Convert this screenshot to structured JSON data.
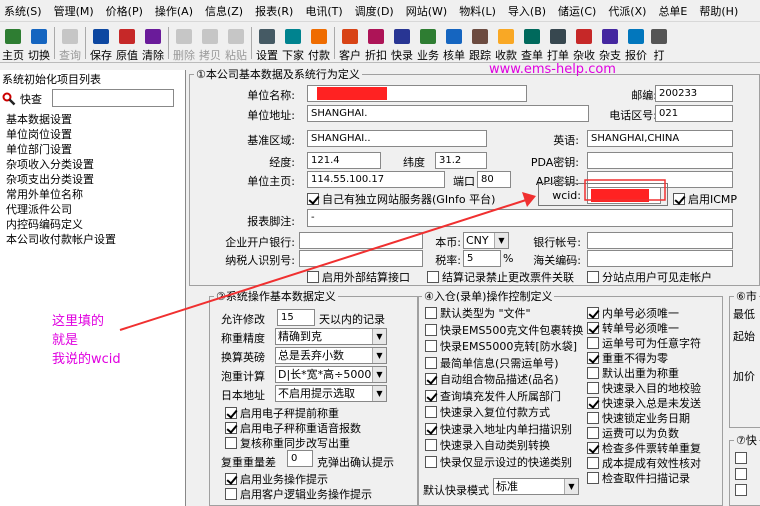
{
  "menu": [
    "系统(S)",
    "管理(M)",
    "价格(P)",
    "操作(A)",
    "信息(Z)",
    "报表(R)",
    "电讯(T)",
    "调度(D)",
    "网站(W)",
    "物料(L)",
    "导入(B)",
    "储运(C)",
    "代派(X)",
    "总单E",
    "帮助(H)"
  ],
  "toolbar": [
    {
      "label": "主页",
      "icon": "home-icon",
      "color": "#2e7d32",
      "disabled": false
    },
    {
      "label": "切换",
      "icon": "switch-icon",
      "color": "#1565c0",
      "disabled": false
    },
    {
      "label": "查询",
      "icon": "query-icon",
      "color": "#777",
      "disabled": true
    },
    {
      "label": "保存",
      "icon": "save-icon",
      "color": "#0d47a1",
      "disabled": false
    },
    {
      "label": "原值",
      "icon": "original-value-icon",
      "color": "#c62828",
      "disabled": false
    },
    {
      "label": "清除",
      "icon": "clear-icon",
      "color": "#6a1b9a",
      "disabled": false
    },
    {
      "label": "删除",
      "icon": "delete-icon",
      "color": "#777",
      "disabled": true
    },
    {
      "label": "拷贝",
      "icon": "copy-icon",
      "color": "#777",
      "disabled": true
    },
    {
      "label": "粘贴",
      "icon": "paste-icon",
      "color": "#777",
      "disabled": true
    },
    {
      "label": "设置",
      "icon": "settings-icon",
      "color": "#455a64",
      "disabled": false
    },
    {
      "label": "下家",
      "icon": "next-party-icon",
      "color": "#00838f",
      "disabled": false
    },
    {
      "label": "付款",
      "icon": "payment-icon",
      "color": "#ef6c00",
      "disabled": false
    },
    {
      "label": "客户",
      "icon": "customer-icon",
      "color": "#d84315",
      "disabled": false
    },
    {
      "label": "折扣",
      "icon": "discount-icon",
      "color": "#ad1457",
      "disabled": false
    },
    {
      "label": "快录",
      "icon": "quick-entry-icon",
      "color": "#283593",
      "disabled": false
    },
    {
      "label": "业务",
      "icon": "business-icon",
      "color": "#2e7d32",
      "disabled": false
    },
    {
      "label": "核单",
      "icon": "verify-icon",
      "color": "#1565c0",
      "disabled": false
    },
    {
      "label": "跟踪",
      "icon": "tracking-icon",
      "color": "#6d4c41",
      "disabled": false
    },
    {
      "label": "收款",
      "icon": "receipt-icon",
      "color": "#f9a825",
      "disabled": false
    },
    {
      "label": "查单",
      "icon": "check-order-icon",
      "color": "#00695c",
      "disabled": false
    },
    {
      "label": "打单",
      "icon": "print-icon",
      "color": "#37474f",
      "disabled": false
    },
    {
      "label": "杂收",
      "icon": "misc-income-icon",
      "color": "#c62828",
      "disabled": false
    },
    {
      "label": "杂支",
      "icon": "misc-expense-icon",
      "color": "#4527a0",
      "disabled": false
    },
    {
      "label": "报价",
      "icon": "quote-icon",
      "color": "#0277bd",
      "disabled": false
    },
    {
      "label": "打",
      "icon": "print2-icon",
      "color": "#555",
      "disabled": false
    }
  ],
  "left_panel": {
    "title": "系统初始化项目列表",
    "search_label": "快查",
    "items": [
      "基本数据设置",
      "单位岗位设置",
      "单位部门设置",
      "杂项收入分类设置",
      "杂项支出分类设置",
      "常用外单位名称",
      "代理派件公司",
      "内控码编码定义",
      "本公司收付款帐户设置"
    ]
  },
  "watermark": "www.ems-help.com",
  "annotation": "这里填的\n就是\n我说的wcid",
  "section1": {
    "legend": "①本公司基本数据及系统行为定义",
    "unit_name_label": "单位名称:",
    "postcode_label": "邮编:",
    "postcode": "200233",
    "address_label": "单位地址:",
    "address": "SHANGHAI.",
    "area_code_label": "电话区号:",
    "area_code": "021",
    "region_label": "基准区域:",
    "region": "SHANGHAI..",
    "english_label": "英语:",
    "english": "SHANGHAI,CHINA",
    "longitude_label": "经度:",
    "longitude": "121.4",
    "latitude_label": "纬度",
    "latitude": "31.2",
    "pda_label": "PDA密钥:",
    "homepage_label": "单位主页:",
    "homepage": "114.55.100.17",
    "port_label": "端口",
    "port": "80",
    "api_label": "API密钥:",
    "own_server_label": "自己有独立网站服务器(GInfo 平台)",
    "wcid_label": "wcid:",
    "enable_icmp_label": "启用ICMP",
    "footer_label": "报表脚注:",
    "footer": "-",
    "bank_label": "企业开户银行:",
    "currency_label": "本币:",
    "currency": "CNY",
    "account_label": "银行帐号:",
    "taxpayer_label": "纳税人识别号:",
    "tax_rate_label": "税率:",
    "tax_rate": "5",
    "percent": "%",
    "customs_label": "海关编码:",
    "ext_settle_label": "启用外部结算接口",
    "settle_forbid_label": "结算记录禁止更改票件关联",
    "branch_visible_label": "分站点用户可见走帐户"
  },
  "section2": {
    "legend": "②系统操作基本数据定义",
    "allow_modify_label": "允许修改",
    "allow_modify": "15",
    "allow_modify_suffix": "天以内的记录",
    "weight_precision_label": "称重精度",
    "weight_precision": "精确到克",
    "conversion_label": "换算英磅",
    "conversion": "总是丢弃小数",
    "volume_label": "泡重计算",
    "volume": "D|长*宽*高÷5000",
    "jp_address_label": "日本地址",
    "jp_address": "不启用提示选取",
    "cb1": "启用电子秤提前称重",
    "cb2": "启用电子秤称重语音报数",
    "cb3": "复核称重同步改写出重",
    "recheck_label": "复重重量差",
    "recheck": "0",
    "recheck_suffix": "克弹出确认提示",
    "cb4": "启用业务操作提示",
    "cb5": "启用客户逻辑业务操作提示"
  },
  "section4": {
    "legend": "④入仓(录单)操作控制定义",
    "left": [
      {
        "label": "默认类型为 \"文件\"",
        "on": false
      },
      {
        "label": "快录EMS500克文件包裹转换",
        "on": false
      },
      {
        "label": "快录EMS5000克转[防水袋]",
        "on": false
      },
      {
        "label": "最简单信息(只需运单号)",
        "on": false
      },
      {
        "label": "自动组合物品描述(品名)",
        "on": true
      },
      {
        "label": "查询填充发件人所属部门",
        "on": true
      },
      {
        "label": "快速录入复位付款方式",
        "on": false
      },
      {
        "label": "快速录入地址内单扫描识别",
        "on": true
      },
      {
        "label": "快速录入自动类别转换",
        "on": false
      },
      {
        "label": "快录仅显示设过的快递类别",
        "on": false
      }
    ],
    "right": [
      {
        "label": "内单号必须唯一",
        "on": true
      },
      {
        "label": "转单号必须唯一",
        "on": true
      },
      {
        "label": "运单号可为任意字符",
        "on": false
      },
      {
        "label": "重重不得为零",
        "on": true
      },
      {
        "label": "默认出重为称重",
        "on": false
      },
      {
        "label": "快速录入目的地校验",
        "on": false
      },
      {
        "label": "快速录入总是未发送",
        "on": true
      },
      {
        "label": "快速锁定业务日期",
        "on": false
      },
      {
        "label": "运费可以为负数",
        "on": false
      },
      {
        "label": "检查多件票转单重复",
        "on": true
      },
      {
        "label": "成本提成有效性核对",
        "on": false
      },
      {
        "label": "检查取件扫描记录",
        "on": false
      }
    ],
    "default_mode_label": "默认快录模式",
    "default_mode": "标准"
  },
  "section6": {
    "legend": "⑥市",
    "lines": [
      "最低",
      "起始",
      "加价"
    ]
  },
  "section7": {
    "legend": "⑦快"
  }
}
